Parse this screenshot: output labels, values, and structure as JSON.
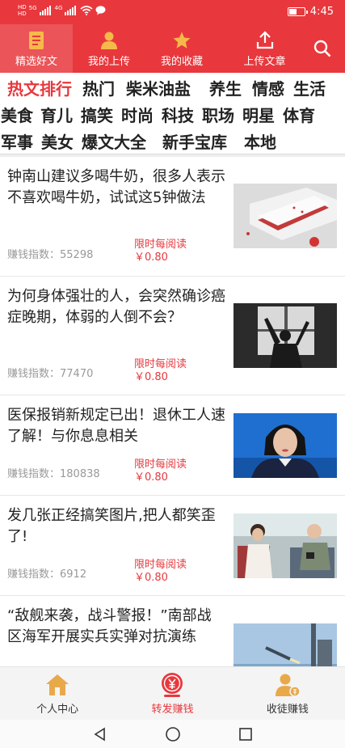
{
  "status_bar": {
    "sim1": "HD",
    "sim2": "HD",
    "net1": "5G",
    "net2": "4G",
    "time": "4:45",
    "battery_level": 0.45
  },
  "top_nav": {
    "tabs": [
      {
        "label": "精选好文",
        "icon": "document-icon"
      },
      {
        "label": "我的上传",
        "icon": "person-icon"
      },
      {
        "label": "我的收藏",
        "icon": "star-icon"
      },
      {
        "label": "上传文章",
        "icon": "upload-icon"
      }
    ],
    "search_icon": "search-icon",
    "active_tab": 0
  },
  "categories": {
    "rows": [
      [
        "热文排行",
        "热门",
        "柴米油盐",
        "养生",
        "情感",
        "生活"
      ],
      [
        "美食",
        "育儿",
        "搞笑",
        "时尚",
        "科技",
        "职场",
        "明星",
        "体育"
      ],
      [
        "军事",
        "美女",
        "爆文大全",
        "新手宝库",
        "本地"
      ]
    ],
    "active": "热文排行"
  },
  "articles": [
    {
      "title": "钟南山建议多喝牛奶，很多人表示不喜欢喝牛奶，试试这5钟做法",
      "earn_label": "赚钱指数：",
      "earn_value": "55298",
      "reward_label": "限时每阅读",
      "reward_value": "￥0.80",
      "image": "milk-dessert-photo"
    },
    {
      "title": "为何身体强壮的人，会突然确诊癌症晚期，体弱的人倒不会？",
      "earn_label": "赚钱指数：",
      "earn_value": "77470",
      "reward_label": "限时每阅读",
      "reward_value": "￥0.80",
      "image": "man-at-window-photo"
    },
    {
      "title": "医保报销新规定已出！退休工人速了解！与你息息相关",
      "earn_label": "赚钱指数：",
      "earn_value": "180838",
      "reward_label": "限时每阅读",
      "reward_value": "￥0.80",
      "image": "news-anchor-photo"
    },
    {
      "title": "发几张正经搞笑图片,把人都笑歪了!",
      "earn_label": "赚钱指数：",
      "earn_value": "6912",
      "reward_label": "限时每阅读",
      "reward_value": "￥0.80",
      "image": "bus-passengers-photo"
    },
    {
      "title": "“敌舰来袭，战斗警报！”南部战区海军开展实兵实弹对抗演练",
      "earn_label": "",
      "earn_value": "",
      "reward_label": "",
      "reward_value": "",
      "image": "missile-launch-photo"
    }
  ],
  "bottom_nav": {
    "tabs": [
      {
        "label": "个人中心",
        "icon": "house-icon"
      },
      {
        "label": "转发赚钱",
        "icon": "money-badge-icon"
      },
      {
        "label": "收徒赚钱",
        "icon": "user-coin-icon"
      }
    ],
    "active_tab": 1
  },
  "colors": {
    "brand_red": "#e8383d",
    "text_dark": "#222222",
    "text_gray": "#999999"
  }
}
